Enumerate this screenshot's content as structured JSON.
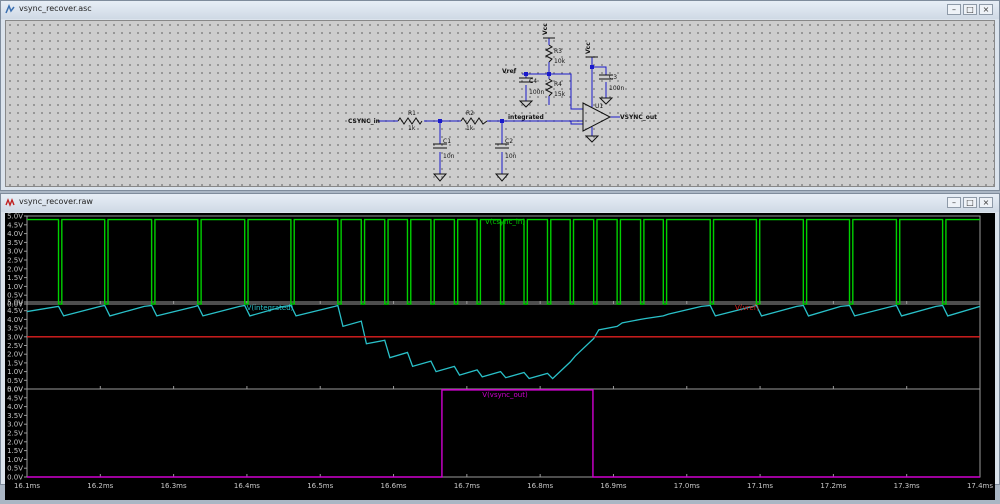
{
  "schematic_window": {
    "title": "vsync_recover.asc",
    "components": {
      "vcc_r3": "Vcc",
      "vcc_u1": "Vcc",
      "r3_name": "R3",
      "r3_value": "10k",
      "vref_label": "Vref",
      "c4_name": "C4",
      "c4_value": "100n",
      "r4_name": "R4",
      "r4_value": "15k",
      "c3_name": "C3",
      "c3_value": "100n",
      "u1_name": "U1",
      "csync_in_label": "CSYNC_in",
      "r1_name": "R1",
      "r1_value": "1k",
      "r2_name": "R2",
      "r2_value": "1k",
      "integrated_label": "integrated",
      "vsync_out_label": "VSYNC_out",
      "c1_name": "C1",
      "c1_value": "10n",
      "c2_name": "C2",
      "c2_value": "10n"
    }
  },
  "waveform_window": {
    "title": "vsync_recover.raw",
    "colors": {
      "csync": "#00d000",
      "integrated": "#29c0c8",
      "vref": "#e02020",
      "vsync": "#d000d0",
      "grid": "#9a9a9a",
      "axis_text": "#c8c8c8"
    },
    "panes": [
      {
        "trace_labels": [
          "V(csync_in)"
        ],
        "y_ticks": [
          "5.0V",
          "4.5V",
          "4.0V",
          "3.5V",
          "3.0V",
          "2.5V",
          "2.0V",
          "1.5V",
          "1.0V",
          "0.5V",
          "0.0V"
        ]
      },
      {
        "trace_labels": [
          "V(integrated)",
          "V(vref)"
        ],
        "y_ticks": [
          "5.0V",
          "4.5V",
          "4.0V",
          "3.5V",
          "3.0V",
          "2.5V",
          "2.0V",
          "1.5V",
          "1.0V",
          "0.5V",
          "0.0V"
        ]
      },
      {
        "trace_labels": [
          "V(vsync_out)"
        ],
        "y_ticks": [
          "5.0V",
          "4.5V",
          "4.0V",
          "3.5V",
          "3.0V",
          "2.5V",
          "2.0V",
          "1.5V",
          "1.0V",
          "0.5V",
          "0.0V"
        ]
      }
    ],
    "x_ticks": [
      "16.1ms",
      "16.2ms",
      "16.3ms",
      "16.4ms",
      "16.5ms",
      "16.6ms",
      "16.7ms",
      "16.8ms",
      "16.9ms",
      "17.0ms",
      "17.1ms",
      "17.2ms",
      "17.3ms",
      "17.4ms"
    ]
  },
  "chart_data": {
    "type": "line",
    "xlabel": "",
    "xlim": [
      16.1,
      17.4
    ],
    "x_unit": "ms",
    "series": [
      {
        "name": "V(csync_in)",
        "ylim": [
          0,
          5
        ],
        "high": 4.8,
        "low": 0.0,
        "low_pulses_ms": [
          16.143,
          16.206,
          16.27,
          16.333,
          16.397,
          16.46,
          16.524,
          16.556,
          16.588,
          16.619,
          16.651,
          16.683,
          16.714,
          16.746,
          16.778,
          16.81,
          16.841,
          16.873,
          16.905,
          16.937,
          16.968,
          17.032,
          17.095,
          17.159,
          17.222,
          17.286,
          17.349
        ]
      },
      {
        "name": "V(integrated)",
        "ylim": [
          0,
          5
        ],
        "x": [
          16.1,
          16.143,
          16.15,
          16.2,
          16.206,
          16.213,
          16.26,
          16.27,
          16.277,
          16.33,
          16.333,
          16.34,
          16.39,
          16.397,
          16.404,
          16.45,
          16.46,
          16.467,
          16.52,
          16.524,
          16.531,
          16.556,
          16.563,
          16.588,
          16.595,
          16.619,
          16.626,
          16.651,
          16.658,
          16.683,
          16.69,
          16.714,
          16.721,
          16.746,
          16.753,
          16.778,
          16.785,
          16.81,
          16.817,
          16.841,
          16.848,
          16.873,
          16.88,
          16.905,
          16.912,
          16.937,
          16.944,
          16.968,
          16.975,
          17.02,
          17.032,
          17.039,
          17.09,
          17.095,
          17.102,
          17.15,
          17.159,
          17.166,
          17.21,
          17.222,
          17.229,
          17.28,
          17.286,
          17.293,
          17.34,
          17.349,
          17.356,
          17.4
        ],
        "y": [
          4.45,
          4.75,
          4.2,
          4.75,
          4.8,
          4.2,
          4.75,
          4.8,
          4.2,
          4.75,
          4.8,
          4.2,
          4.75,
          4.8,
          4.2,
          4.75,
          4.8,
          4.2,
          4.75,
          4.8,
          3.6,
          3.9,
          2.6,
          2.8,
          1.8,
          2.1,
          1.3,
          1.6,
          1.0,
          1.3,
          0.8,
          1.1,
          0.7,
          1.0,
          0.65,
          0.95,
          0.6,
          0.9,
          0.6,
          1.55,
          1.9,
          2.9,
          3.4,
          3.6,
          3.8,
          4.0,
          4.05,
          4.2,
          4.3,
          4.75,
          4.8,
          4.2,
          4.75,
          4.8,
          4.2,
          4.75,
          4.8,
          4.2,
          4.75,
          4.8,
          4.2,
          4.75,
          4.8,
          4.2,
          4.75,
          4.8,
          4.2,
          4.75
        ]
      },
      {
        "name": "V(vref)",
        "ylim": [
          0,
          5
        ],
        "x": [
          16.1,
          17.4
        ],
        "y": [
          3.0,
          3.0
        ]
      },
      {
        "name": "V(vsync_out)",
        "ylim": [
          0,
          5
        ],
        "x": [
          16.1,
          16.666,
          16.666,
          16.872,
          16.872,
          17.4
        ],
        "y": [
          0.0,
          0.0,
          4.95,
          4.95,
          0.0,
          0.0
        ]
      }
    ]
  }
}
